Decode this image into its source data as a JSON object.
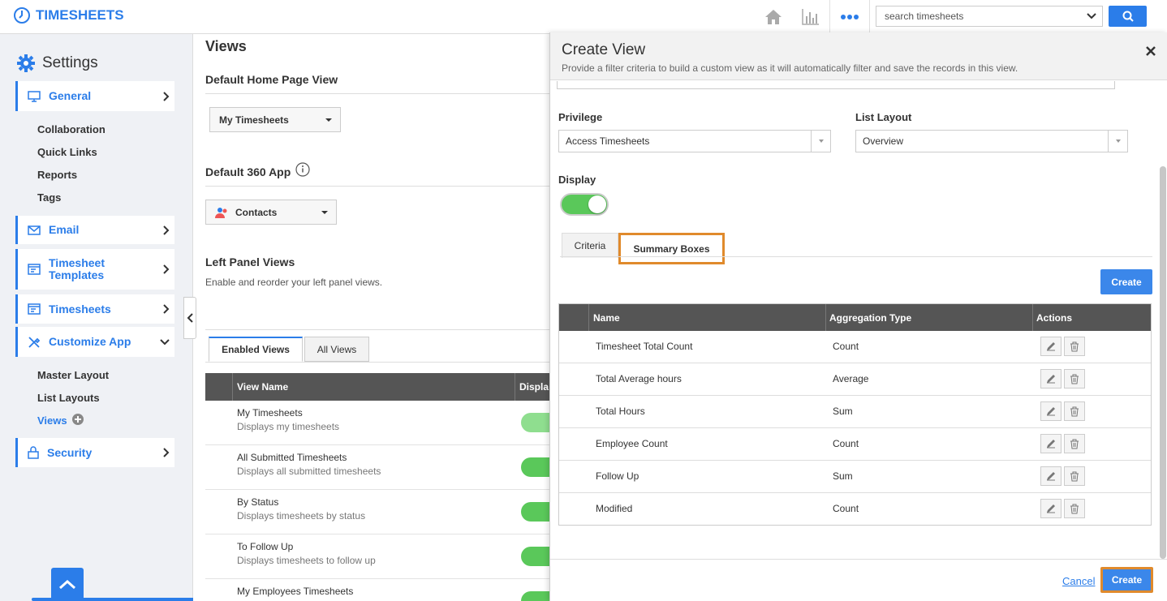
{
  "app": {
    "title": "TIMESHEETS"
  },
  "search": {
    "placeholder": "search timesheets"
  },
  "topnav": {
    "icons": [
      "home-icon",
      "chart-icon",
      "more-dots-icon"
    ]
  },
  "sidebar": {
    "title": "Settings",
    "items": [
      {
        "label": "General"
      },
      {
        "label": "Email"
      },
      {
        "label": "Timesheet Templates"
      },
      {
        "label": "Timesheets"
      },
      {
        "label": "Customize App"
      },
      {
        "label": "Security"
      }
    ],
    "general_sub": [
      "Collaboration",
      "Quick Links",
      "Reports",
      "Tags"
    ],
    "customize_sub": [
      "Master Layout",
      "List Layouts",
      "Views"
    ]
  },
  "main": {
    "title": "Views",
    "default_home": {
      "heading": "Default Home Page View",
      "value": "My Timesheets"
    },
    "default_360": {
      "heading": "Default 360 App",
      "value": "Contacts"
    },
    "left_panel": {
      "heading": "Left Panel Views",
      "desc": "Enable and reorder your left panel views."
    },
    "tabs": [
      "Enabled Views",
      "All Views"
    ],
    "table": {
      "headers": [
        "View Name",
        "Displa"
      ],
      "rows": [
        {
          "name": "My Timesheets",
          "desc": "Displays my timesheets"
        },
        {
          "name": "All Submitted Timesheets",
          "desc": "Displays all submitted timesheets"
        },
        {
          "name": "By Status",
          "desc": "Displays timesheets by status"
        },
        {
          "name": "To Follow Up",
          "desc": "Displays timesheets to follow up"
        },
        {
          "name": "My Employees Timesheets",
          "desc": ""
        }
      ]
    }
  },
  "dialog": {
    "title": "Create View",
    "subtitle": "Provide a filter criteria to build a custom view as it will automatically filter and save the records in this view.",
    "privilege": {
      "label": "Privilege",
      "value": "Access Timesheets"
    },
    "list_layout": {
      "label": "List Layout",
      "value": "Overview"
    },
    "display": {
      "label": "Display",
      "enabled": true
    },
    "tabs": [
      "Criteria",
      "Summary Boxes"
    ],
    "create_label": "Create",
    "table": {
      "headers": [
        "Name",
        "Aggregation Type",
        "Actions"
      ],
      "rows": [
        {
          "name": "Timesheet Total Count",
          "type": "Count"
        },
        {
          "name": "Total Average hours",
          "type": "Average"
        },
        {
          "name": "Total Hours",
          "type": "Sum"
        },
        {
          "name": "Employee Count",
          "type": "Count"
        },
        {
          "name": "Follow Up",
          "type": "Sum"
        },
        {
          "name": "Modified",
          "type": "Count"
        }
      ]
    },
    "footer": {
      "cancel": "Cancel",
      "create": "Create"
    }
  },
  "colors": {
    "accent": "#2b7de9",
    "toggle_on": "#5ac85a",
    "highlight": "#e08a2c"
  }
}
